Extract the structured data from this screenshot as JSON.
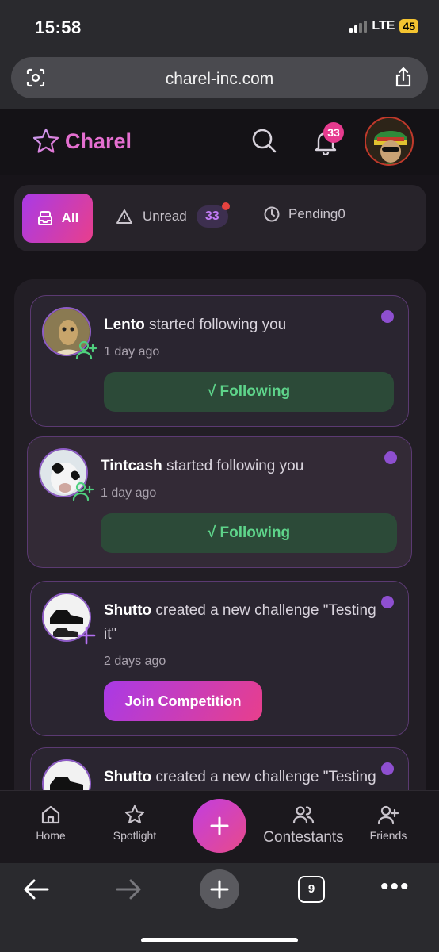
{
  "status_bar": {
    "time": "15:58",
    "network": "LTE",
    "battery": "45"
  },
  "browser": {
    "url": "charel-inc.com",
    "open_tabs": "9"
  },
  "app": {
    "brand": "Charel",
    "notification_count": "33",
    "accent_colors": {
      "pink": "#e46fd0",
      "purple": "#a93ae6",
      "magenta": "#e83f8c",
      "green": "#5ed48a"
    }
  },
  "tabs": {
    "all_label": "All",
    "unread_label": "Unread",
    "unread_count": "33",
    "pending_label": "Pending0"
  },
  "notifications": [
    {
      "user": "Lento",
      "action": " started following you",
      "time": "1 day ago",
      "button": "√ Following",
      "icon": "user-plus-icon"
    },
    {
      "user": "Tintcash",
      "action": " started following you",
      "time": "1 day ago",
      "button": "√ Following",
      "icon": "user-plus-icon"
    },
    {
      "user": "Shutto",
      "action": " created a new challenge \"Testing it\"",
      "time": "2 days ago",
      "button": "Join Competition",
      "icon": "plus-icon"
    },
    {
      "user": "Shutto",
      "action": " created a new challenge \"Testing",
      "time": "",
      "button": "",
      "icon": "plus-icon"
    }
  ],
  "bottom_nav": {
    "home": "Home",
    "spotlight": "Spotlight",
    "contestants": "Contestants",
    "friends": "Friends"
  }
}
